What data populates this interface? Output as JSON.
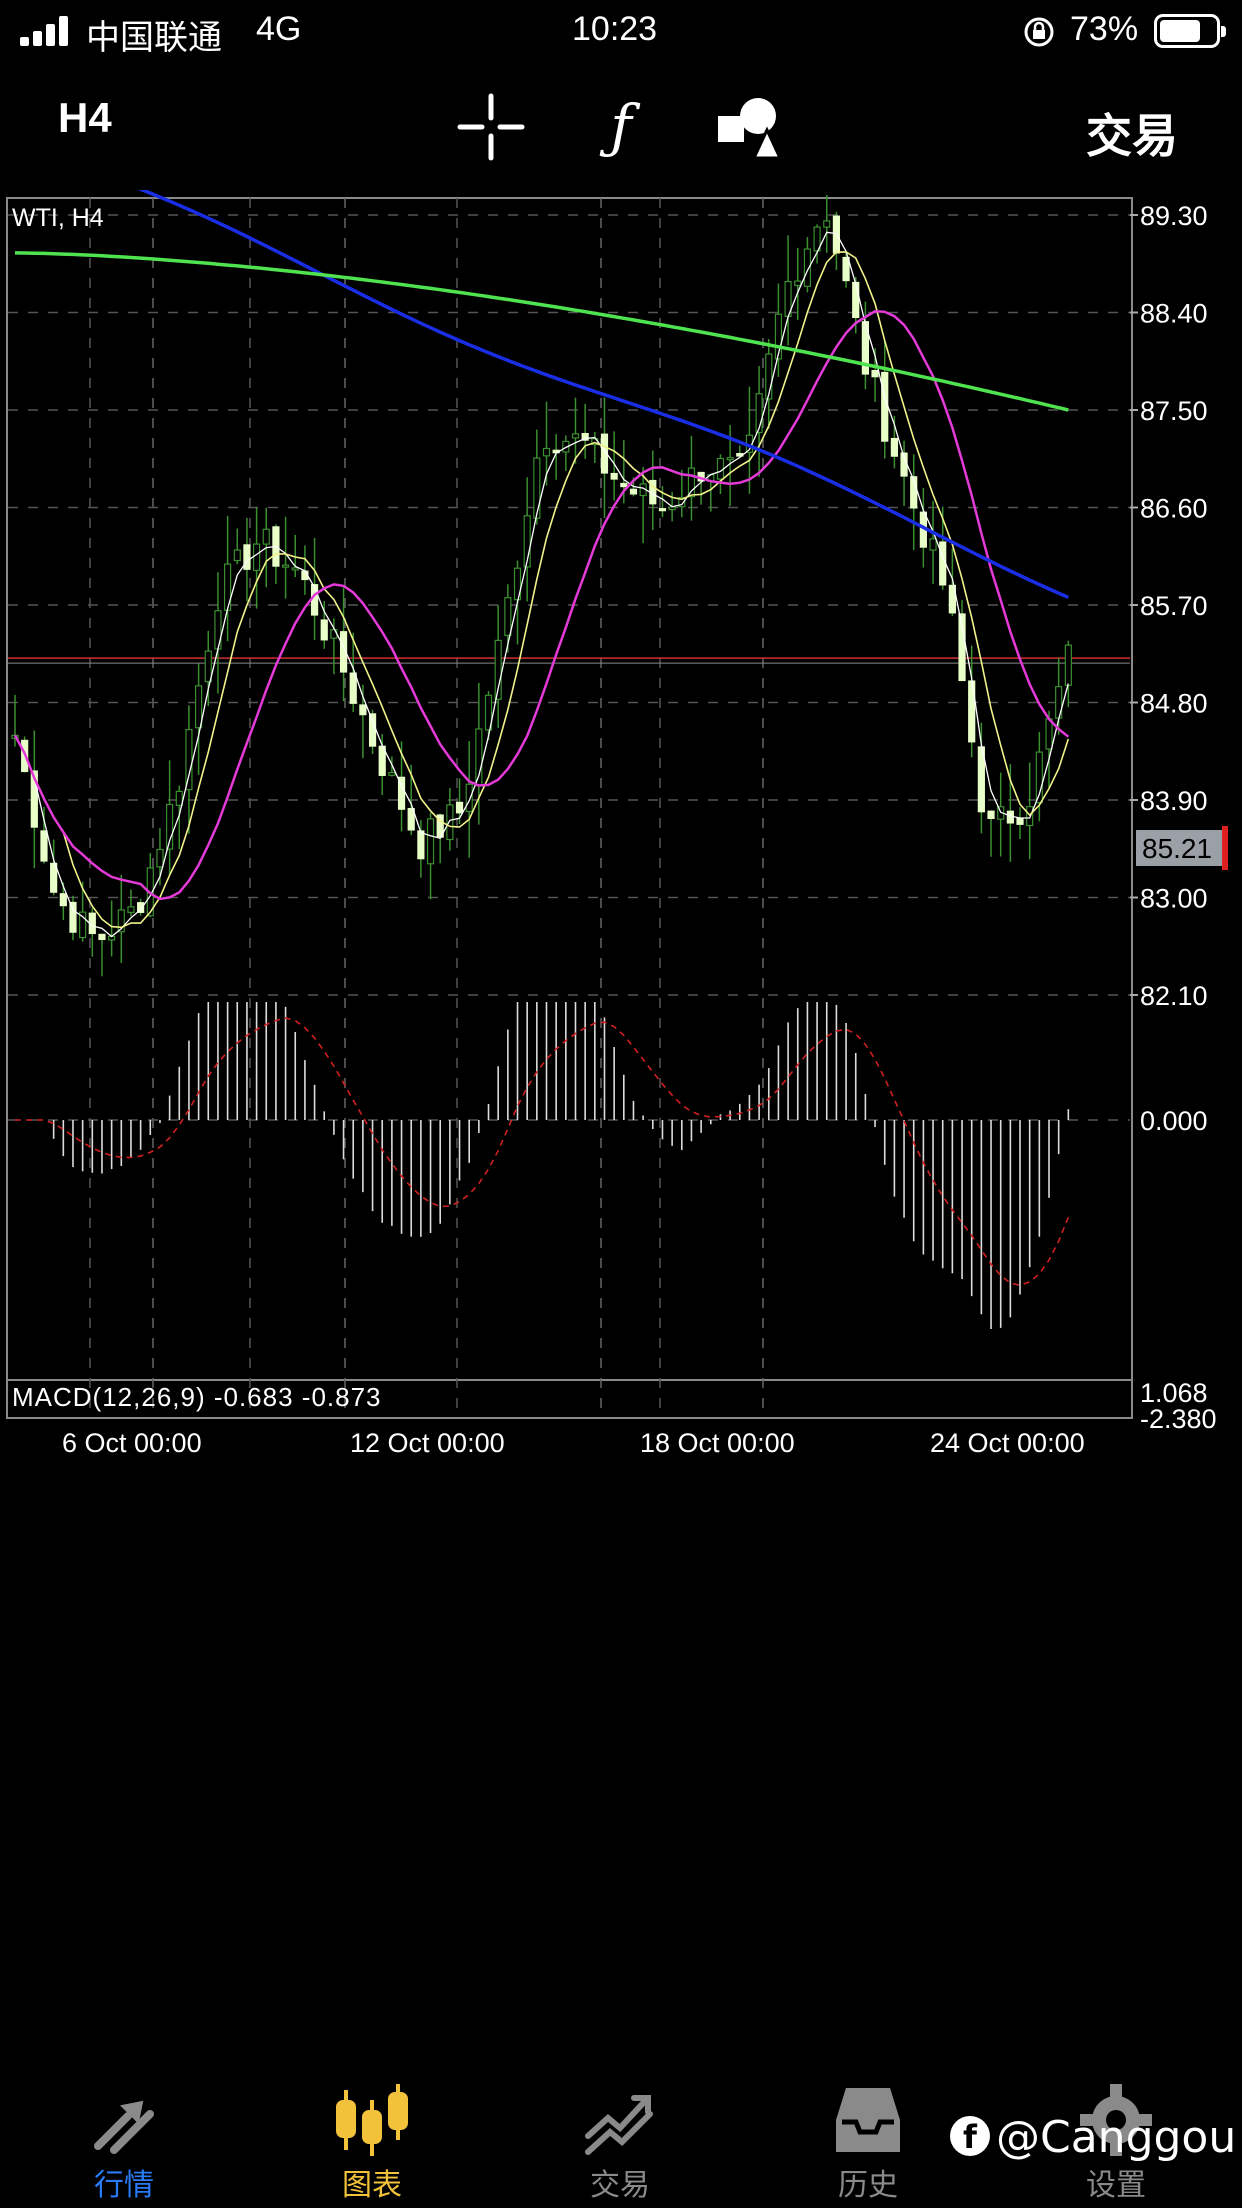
{
  "status_bar": {
    "carrier": "中国联通",
    "network": "4G",
    "time": "10:23",
    "battery": "73%",
    "battery_level": 0.73
  },
  "toolbar": {
    "timeframe": "H4",
    "icons": [
      "crosshair-icon",
      "function-icon",
      "objects-icon"
    ],
    "trade_label": "交易"
  },
  "chart": {
    "symbol_label": "WTI, H4",
    "current_price": "85.21",
    "price_ticks": [
      "89.30",
      "88.40",
      "87.50",
      "86.60",
      "85.70",
      "84.80",
      "83.90",
      "83.00",
      "82.10"
    ],
    "date_labels": [
      "6 Oct 00:00",
      "12 Oct 00:00",
      "18 Oct 00:00",
      "24 Oct 00:00"
    ],
    "macd_label": "MACD(12,26,9) -0.683 -0.873",
    "macd_ticks": [
      "1.068",
      "0.000",
      "-2.380"
    ],
    "colors": {
      "bull_candle": "#3a8f2f",
      "bear_candle": "#e8ffc8",
      "ma_blue": "#1a2ee6",
      "ma_green": "#4fe34f",
      "ma_magenta": "#e43ad8",
      "ma_yellow": "#f2f28a",
      "ma_white": "#ffffff",
      "signal_line": "#d02020",
      "price_line": "#d03030"
    }
  },
  "chart_data": {
    "type": "candlestick",
    "title": "WTI, H4",
    "y_range": [
      81.15,
      90.4
    ],
    "current_price": 85.21,
    "x_ticks": [
      "6 Oct 00:00",
      "12 Oct 00:00",
      "18 Oct 00:00",
      "24 Oct 00:00"
    ],
    "close_path": [
      84.5,
      83.0,
      82.6,
      82.9,
      84.0,
      85.8,
      86.3,
      86.0,
      85.2,
      84.3,
      83.5,
      83.8,
      85.4,
      87.3,
      87.2,
      86.8,
      86.6,
      87.0,
      86.9,
      88.6,
      89.4,
      87.9,
      86.8,
      85.8,
      83.6,
      83.9,
      85.2
    ],
    "macd_range": [
      -2.38,
      1.068
    ],
    "macd_main_last": -0.683,
    "macd_signal_last": -0.873
  },
  "nav": {
    "items": [
      {
        "label": "行情",
        "icon": "quotes-icon"
      },
      {
        "label": "图表",
        "icon": "chart-icon"
      },
      {
        "label": "交易",
        "icon": "trade-icon"
      },
      {
        "label": "历史",
        "icon": "history-icon"
      },
      {
        "label": "设置",
        "icon": "settings-icon"
      }
    ]
  },
  "watermark": "@Canggou"
}
